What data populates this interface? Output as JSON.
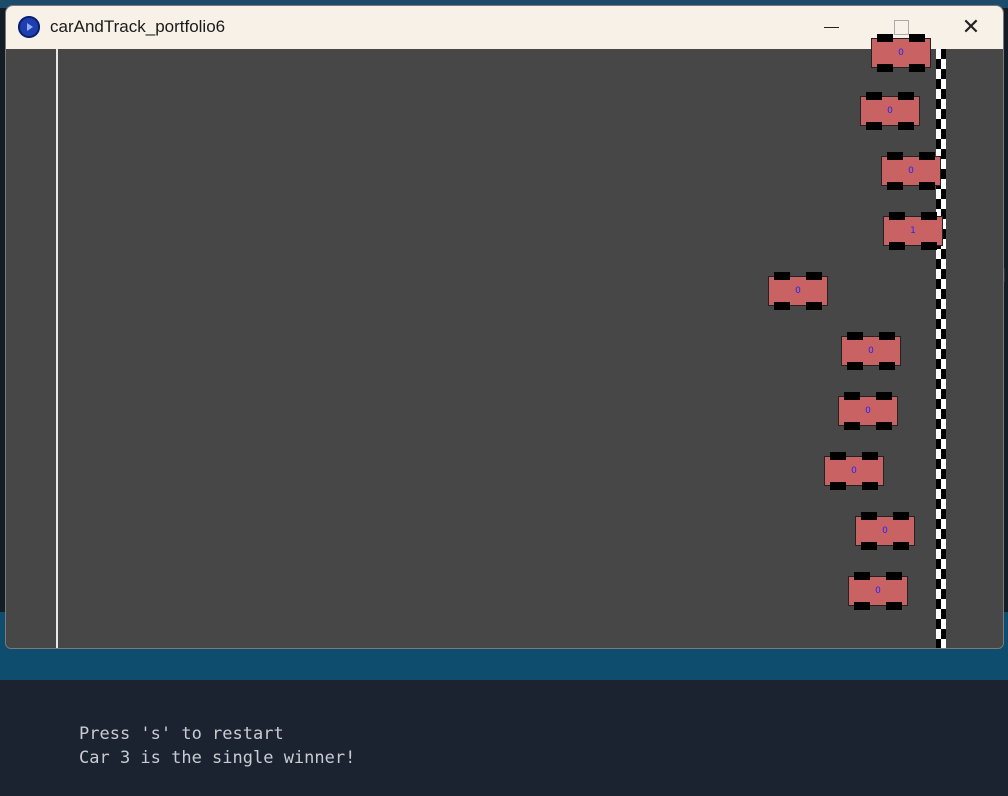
{
  "window": {
    "title": "carAndTrack_portfolio6",
    "minimize_label": "minimize",
    "maximize_label": "maximize",
    "close_label": "close"
  },
  "track": {
    "background": "#474747",
    "car_color": "#c96363",
    "label_color": "#2222ff",
    "cars": [
      {
        "id": 1,
        "label": "0"
      },
      {
        "id": 2,
        "label": "0"
      },
      {
        "id": 3,
        "label": "0"
      },
      {
        "id": 4,
        "label": "1"
      },
      {
        "id": 5,
        "label": "0"
      },
      {
        "id": 6,
        "label": "0"
      },
      {
        "id": 7,
        "label": "0"
      },
      {
        "id": 8,
        "label": "0"
      },
      {
        "id": 9,
        "label": "0"
      },
      {
        "id": 10,
        "label": "0"
      }
    ]
  },
  "console": {
    "line1": "Press 's' to restart",
    "line2": "Car 3 is the single winner!"
  }
}
